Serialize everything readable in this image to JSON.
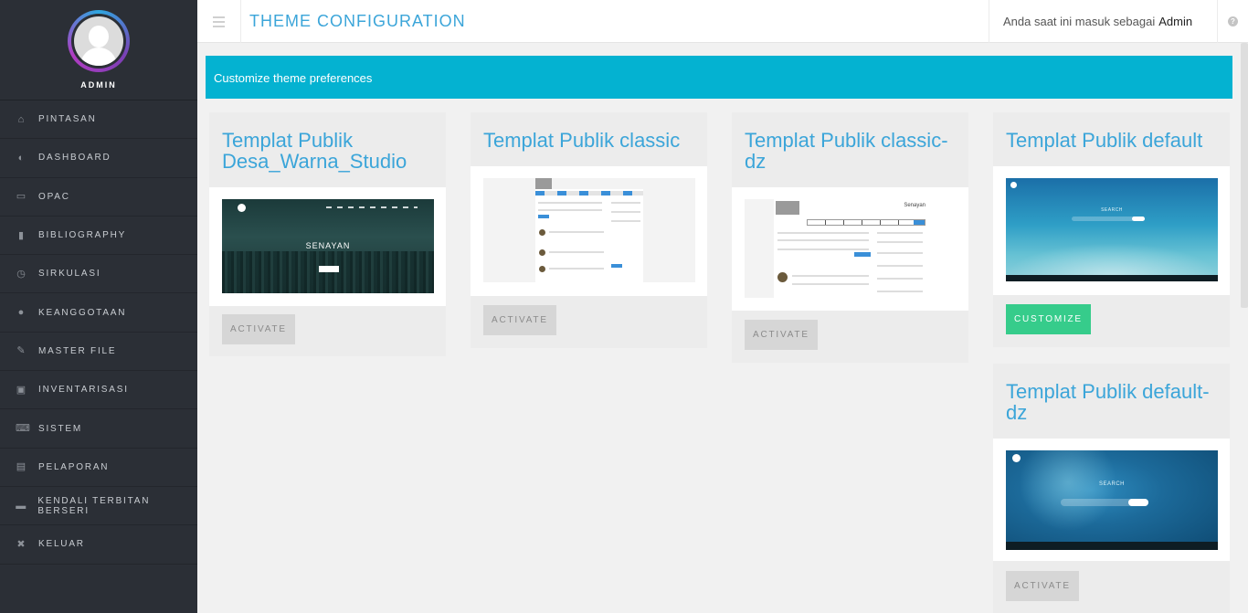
{
  "sidebar": {
    "profile_label": "ADMIN",
    "items": [
      {
        "label": "PINTASAN",
        "icon": "home-icon"
      },
      {
        "label": "DASHBOARD",
        "icon": "dashboard-icon"
      },
      {
        "label": "OPAC",
        "icon": "monitor-icon"
      },
      {
        "label": "BIBLIOGRAPHY",
        "icon": "bookmark-icon"
      },
      {
        "label": "SIRKULASI",
        "icon": "clock-icon"
      },
      {
        "label": "KEANGGOTAAN",
        "icon": "user-icon"
      },
      {
        "label": "MASTER FILE",
        "icon": "pencil-icon"
      },
      {
        "label": "INVENTARISASI",
        "icon": "briefcase-icon"
      },
      {
        "label": "SISTEM",
        "icon": "keyboard-icon"
      },
      {
        "label": "PELAPORAN",
        "icon": "file-icon"
      },
      {
        "label": "KENDALI TERBITAN BERSERI",
        "icon": "newspaper-icon"
      },
      {
        "label": "KELUAR",
        "icon": "close-icon"
      }
    ]
  },
  "header": {
    "title": "THEME CONFIGURATION",
    "login_prefix": "Anda saat ini masuk sebagai",
    "username": "Admin",
    "help_icon": "question-icon"
  },
  "banner": {
    "text": "Customize theme preferences"
  },
  "themes": [
    {
      "title": "Templat Publik Desa_Warna_Studio",
      "button": "ACTIVATE",
      "thumb_text": "SENAYAN"
    },
    {
      "title": "Templat Publik classic",
      "button": "ACTIVATE",
      "thumb_text": ""
    },
    {
      "title": "Templat Publik classic-dz",
      "button": "ACTIVATE",
      "thumb_text": "Senayan"
    },
    {
      "title": "Templat Publik default",
      "button": "CUSTOMIZE",
      "thumb_text": "SEARCH"
    },
    {
      "title": "Templat Publik default-dz",
      "button": "ACTIVATE",
      "thumb_text": "SEARCH"
    }
  ],
  "colors": {
    "sidebar_bg": "#2b2f36",
    "accent": "#3ba5d9",
    "banner": "#04b2d1",
    "customize_button": "#36cc8b"
  }
}
